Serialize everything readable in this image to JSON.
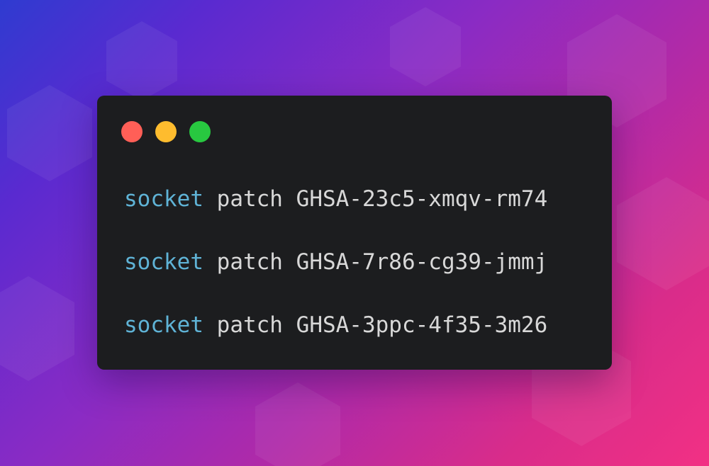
{
  "colors": {
    "background_start": "#2f3bd0",
    "background_end": "#f23084",
    "terminal_bg": "#1c1d1f",
    "command_color": "#5fb3d6",
    "text_color": "#d8d8d8",
    "dot_red": "#ff5f57",
    "dot_yellow": "#febc2e",
    "dot_green": "#28c840"
  },
  "window_controls": [
    {
      "name": "close-dot-icon",
      "color": "red"
    },
    {
      "name": "minimize-dot-icon",
      "color": "yellow"
    },
    {
      "name": "maximize-dot-icon",
      "color": "green"
    }
  ],
  "terminal": {
    "lines": [
      {
        "command": "socket",
        "subcommand": "patch",
        "argument": "GHSA-23c5-xmqv-rm74"
      },
      {
        "command": "socket",
        "subcommand": "patch",
        "argument": "GHSA-7r86-cg39-jmmj"
      },
      {
        "command": "socket",
        "subcommand": "patch",
        "argument": "GHSA-3ppc-4f35-3m26"
      }
    ]
  }
}
